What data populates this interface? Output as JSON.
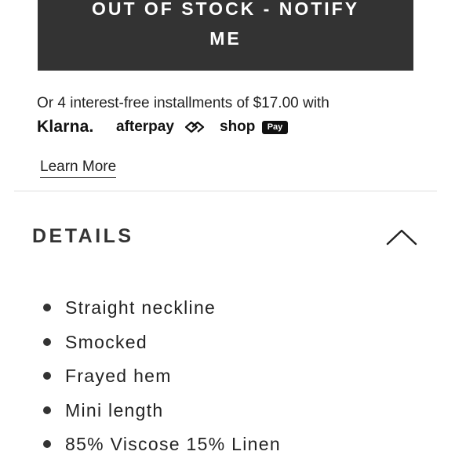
{
  "notify_button": {
    "line1": "OUT OF STOCK - NOTIFY",
    "line2": "ME"
  },
  "installments": {
    "text": "Or 4 interest-free installments of $17.00 with",
    "providers": {
      "klarna": "Klarna.",
      "afterpay": "afterpay",
      "shop": "shop",
      "pay_badge": "Pay"
    }
  },
  "learn_more": "Learn More",
  "details": {
    "title": "DETAILS",
    "expanded": true,
    "chevron_icon": "chevron-up-icon",
    "items": [
      "Straight neckline",
      "Smocked",
      "Frayed hem",
      "Mini length",
      "85% Viscose 15% Linen"
    ]
  },
  "colors": {
    "button_bg": "#333333",
    "button_text": "#ffffff",
    "text": "#222222",
    "divider": "#dddddd"
  }
}
